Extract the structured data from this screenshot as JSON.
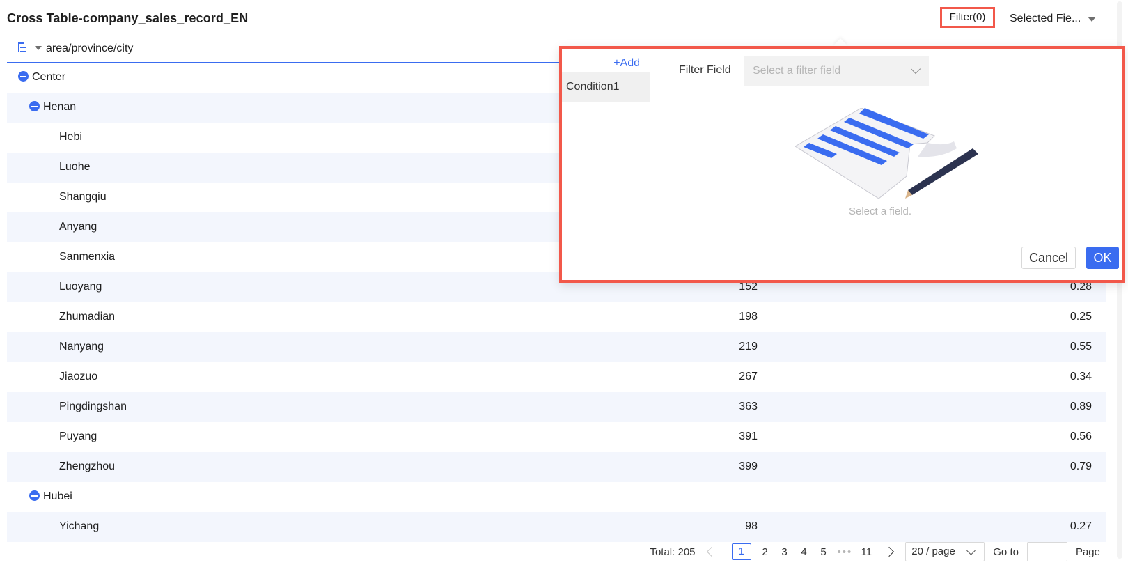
{
  "header": {
    "title": "Cross Table-company_sales_record_EN",
    "filter_label": "Filter(0)",
    "selected_fields_label": "Selected Fie..."
  },
  "table": {
    "row_header": "area/province/city",
    "rows": [
      {
        "label": "Center",
        "level": 0,
        "collapse": true,
        "v1": "",
        "v2": ""
      },
      {
        "label": "Henan",
        "level": 1,
        "collapse": true,
        "v1": "",
        "v2": ""
      },
      {
        "label": "Hebi",
        "level": 2,
        "v1": "",
        "v2": ""
      },
      {
        "label": "Luohe",
        "level": 2,
        "v1": "",
        "v2": ""
      },
      {
        "label": "Shangqiu",
        "level": 2,
        "v1": "",
        "v2": ""
      },
      {
        "label": "Anyang",
        "level": 2,
        "v1": "",
        "v2": ""
      },
      {
        "label": "Sanmenxia",
        "level": 2,
        "v1": "",
        "v2": ""
      },
      {
        "label": "Luoyang",
        "level": 2,
        "v1": "152",
        "v2": "0.28"
      },
      {
        "label": "Zhumadian",
        "level": 2,
        "v1": "198",
        "v2": "0.25"
      },
      {
        "label": "Nanyang",
        "level": 2,
        "v1": "219",
        "v2": "0.55"
      },
      {
        "label": "Jiaozuo",
        "level": 2,
        "v1": "267",
        "v2": "0.34"
      },
      {
        "label": "Pingdingshan",
        "level": 2,
        "v1": "363",
        "v2": "0.89"
      },
      {
        "label": "Puyang",
        "level": 2,
        "v1": "391",
        "v2": "0.56"
      },
      {
        "label": "Zhengzhou",
        "level": 2,
        "v1": "399",
        "v2": "0.79"
      },
      {
        "label": "Hubei",
        "level": 1,
        "collapse": true,
        "v1": "",
        "v2": ""
      },
      {
        "label": "Yichang",
        "level": 2,
        "v1": "98",
        "v2": "0.27"
      }
    ]
  },
  "filter_popup": {
    "add_label": "+Add",
    "condition_label": "Condition1",
    "field_label": "Filter Field",
    "field_placeholder": "Select a filter field",
    "empty_text": "Select a field.",
    "cancel_label": "Cancel",
    "ok_label": "OK"
  },
  "pagination": {
    "total": "Total: 205",
    "pages": [
      "1",
      "2",
      "3",
      "4",
      "5"
    ],
    "current": "1",
    "ellipsis": "•••",
    "last_page": "11",
    "page_size": "20 / page",
    "goto_label": "Go to",
    "page_label": "Page"
  },
  "colors": {
    "accent": "#3a6cf0",
    "highlight_border": "#f2584a",
    "alt_row": "#f3f6fd"
  }
}
